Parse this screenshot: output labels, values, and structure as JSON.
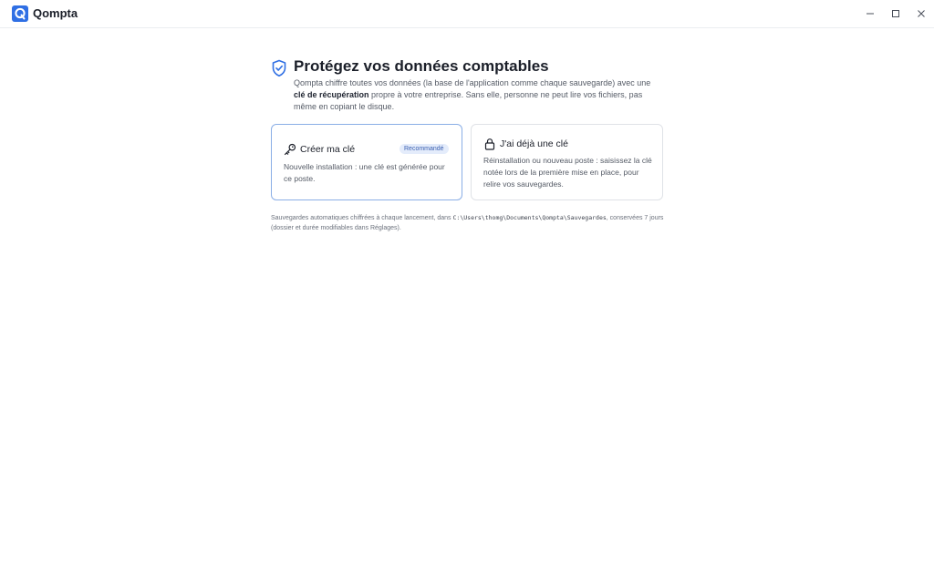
{
  "window": {
    "app_name": "Qompta",
    "logo_letter": "Q",
    "controls": [
      "minimize-icon",
      "maximize-icon",
      "close-icon"
    ]
  },
  "main": {
    "title": "Protégez vos données comptables",
    "intro": {
      "part1": "Qompta chiffre toutes vos données (la base de l'application comme chaque sauvegarde) avec une ",
      "bold": "clé de récupération",
      "part2": " propre à votre entreprise. Sans elle, personne ne peut lire vos fichiers, pas même en copiant le disque."
    },
    "cards": [
      {
        "icon": "key-icon",
        "title": "Créer ma clé",
        "badge": "Recommandé",
        "description": "Nouvelle installation : une clé est générée pour ce poste.",
        "selected": true
      },
      {
        "icon": "lock-icon",
        "title": "J'ai déjà une clé",
        "description": "Réinstallation ou nouveau poste : saisissez la clé notée lors de la première mise en place, pour relire vos sauvegardes.",
        "selected": false
      }
    ],
    "footnote": {
      "part1": "Sauvegardes automatiques chiffrées à chaque lancement, dans ",
      "path": "C:\\Users\\thomg\\Documents\\Qompta\\Sauvegardes",
      "part2": ", conservées 7 jours (dossier et durée modifiables dans Réglages)."
    }
  },
  "colors": {
    "accent": "#2f6fe4",
    "selected_border": "#8aaee6",
    "badge_bg": "#e4ecfb",
    "badge_text": "#3a5fb0"
  }
}
